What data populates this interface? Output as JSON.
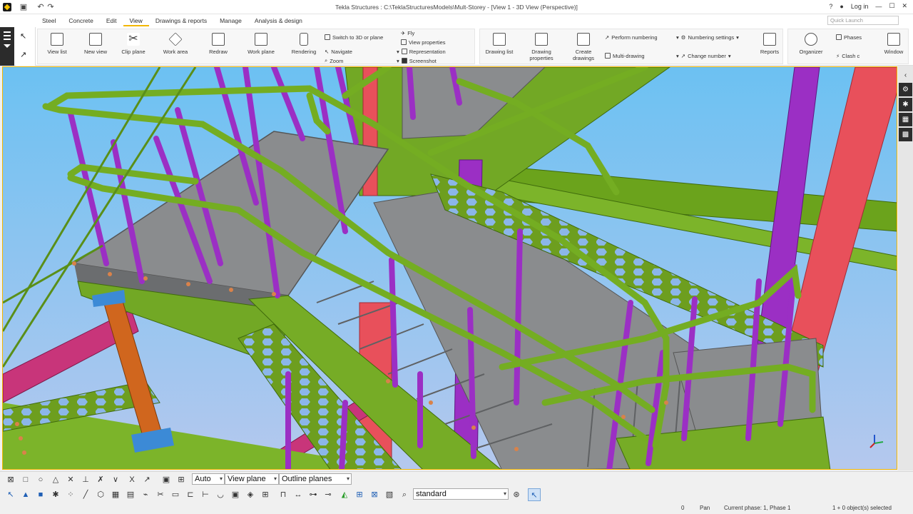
{
  "titlebar": {
    "title": "Tekla Structures : C:\\TeklaStructuresModels\\Mult-Storey - [View 1 - 3D View (Perspective)]",
    "help": "?",
    "login": "Log in"
  },
  "menu_tabs": [
    "Steel",
    "Concrete",
    "Edit",
    "View",
    "Drawings & reports",
    "Manage",
    "Analysis & design"
  ],
  "active_tab": "View",
  "quick_launch_placeholder": "Quick Launch",
  "ribbon": {
    "view_list": "View list",
    "new_view": "New view",
    "clip_plane": "Clip plane",
    "work_area": "Work area",
    "redraw": "Redraw",
    "work_plane": "Work plane",
    "rendering": "Rendering",
    "switch_3d": "Switch to 3D or plane",
    "navigate": "Navigate",
    "zoom": "Zoom",
    "fly": "Fly",
    "view_properties": "View properties",
    "representation": "Representation",
    "screenshot": "Screenshot",
    "drawing_list": "Drawing list",
    "drawing_properties": "Drawing properties",
    "create_drawings": "Create drawings",
    "perform_numbering": "Perform numbering",
    "multi_drawing": "Multi-drawing",
    "numbering_settings": "Numbering settings",
    "change_number": "Change number",
    "reports": "Reports",
    "organizer": "Organizer",
    "phases": "Phases",
    "clash": "Clash c",
    "window": "Window"
  },
  "bottom_toolbar": {
    "auto_select": "Auto",
    "plane_select": "View plane",
    "outline_select": "Outline planes",
    "standard_select": "standard"
  },
  "status": {
    "value": "0",
    "mode": "Pan",
    "phase": "Current phase: 1, Phase 1",
    "selection": "1 + 0 object(s) selected"
  },
  "colors": {
    "accent": "#f2b600",
    "sky": "#7fc7f0",
    "steel_green": "#6fa51e",
    "rail_purple": "#9b2fc4",
    "beam_magenta": "#c8357a",
    "column_red": "#e8505b",
    "post_orange": "#d0661e",
    "grating": "#8a8c8e"
  }
}
